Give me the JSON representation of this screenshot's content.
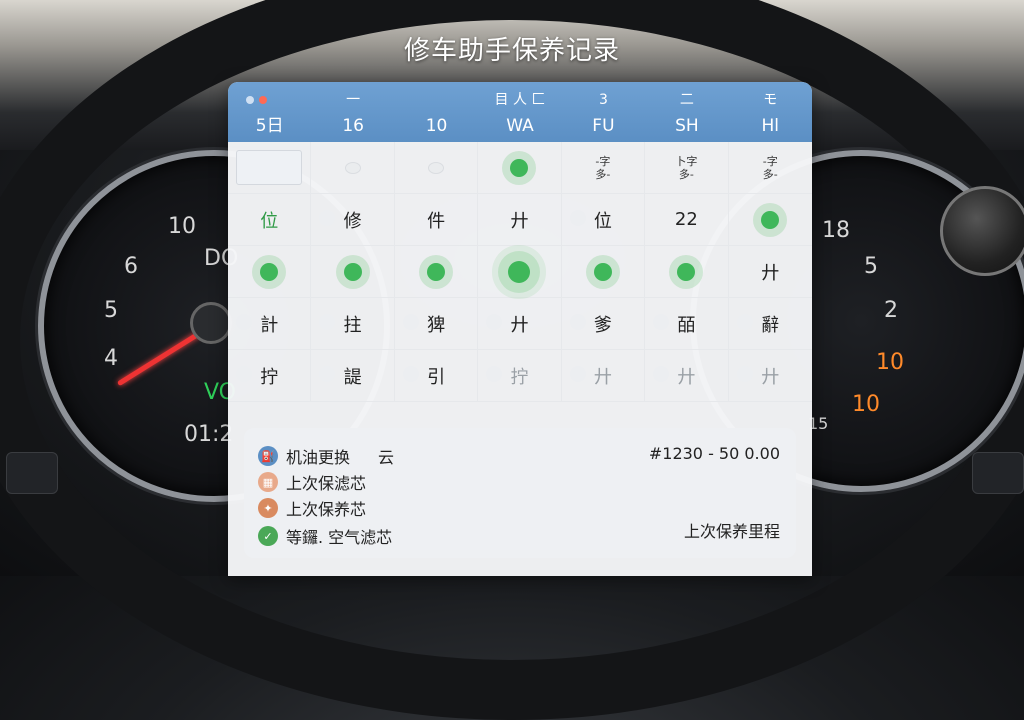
{
  "app": {
    "title": "修车助手保养记录"
  },
  "colors": {
    "header_blue": "#5b8fc4",
    "event_green": "#3fb75a",
    "panel_bg": "#f5f6f8"
  },
  "dashboard": {
    "left_gauge_ticks": [
      "10",
      "6",
      "5",
      "4",
      "DO",
      "VO",
      "01:2"
    ],
    "right_gauge_ticks": [
      "18",
      "5",
      "2",
      "10",
      "10",
      "15"
    ]
  },
  "calendar": {
    "headers": [
      {
        "top": "",
        "bottom": "5日"
      },
      {
        "top": "一",
        "bottom": "16"
      },
      {
        "top": "",
        "bottom": "10"
      },
      {
        "top": "目 人 匚",
        "bottom": "WA"
      },
      {
        "top": "3",
        "bottom": "FU"
      },
      {
        "top": "二",
        "bottom": "SH"
      },
      {
        "top": "モ",
        "bottom": "Hl"
      }
    ],
    "rows": [
      [
        {
          "kind": "box"
        },
        {
          "kind": "mini"
        },
        {
          "kind": "mini"
        },
        {
          "kind": "dot"
        },
        {
          "kind": "two",
          "a": "-字",
          "b": "多-"
        },
        {
          "kind": "two",
          "a": "卜字",
          "b": "多-"
        },
        {
          "kind": "two",
          "a": "-字",
          "b": "多-"
        }
      ],
      [
        {
          "kind": "text",
          "text": "位",
          "style": "green-text"
        },
        {
          "kind": "text",
          "text": "修"
        },
        {
          "kind": "text",
          "text": "件"
        },
        {
          "kind": "text",
          "text": "廾"
        },
        {
          "kind": "text",
          "text": "位"
        },
        {
          "kind": "text",
          "text": "22"
        },
        {
          "kind": "dot"
        }
      ],
      [
        {
          "kind": "dot"
        },
        {
          "kind": "dot"
        },
        {
          "kind": "dot"
        },
        {
          "kind": "dotbig"
        },
        {
          "kind": "dot"
        },
        {
          "kind": "dot"
        },
        {
          "kind": "text",
          "text": "廾"
        }
      ],
      [
        {
          "kind": "text",
          "text": "計"
        },
        {
          "kind": "text",
          "text": "拄"
        },
        {
          "kind": "text",
          "text": "猈"
        },
        {
          "kind": "text",
          "text": "廾"
        },
        {
          "kind": "text",
          "text": "爹"
        },
        {
          "kind": "text",
          "text": "皕"
        },
        {
          "kind": "text",
          "text": "辭"
        }
      ],
      [
        {
          "kind": "text",
          "text": "拧"
        },
        {
          "kind": "text",
          "text": "諟"
        },
        {
          "kind": "text",
          "text": "引"
        },
        {
          "kind": "text",
          "text": "拧",
          "style": "faded"
        },
        {
          "kind": "text",
          "text": "廾",
          "style": "faded"
        },
        {
          "kind": "text",
          "text": "廾",
          "style": "faded"
        },
        {
          "kind": "text",
          "text": "廾",
          "style": "faded"
        }
      ]
    ]
  },
  "legend": {
    "items": [
      {
        "label": "机油更换",
        "extra": "云",
        "icon": "oil-can-icon",
        "color": "#5b8fc4"
      },
      {
        "label": "上次保滤芯",
        "icon": "filter-icon",
        "color": "#e8a98a"
      },
      {
        "label": "上次保养芯",
        "icon": "wrench-icon",
        "color": "#d98a5f"
      },
      {
        "label": "等鑼. 空气滤芯",
        "icon": "check-icon",
        "color": "#4aa857"
      }
    ],
    "cost_text": "#1230 - 50 0.00",
    "mileage_label": "上次保养里程"
  }
}
